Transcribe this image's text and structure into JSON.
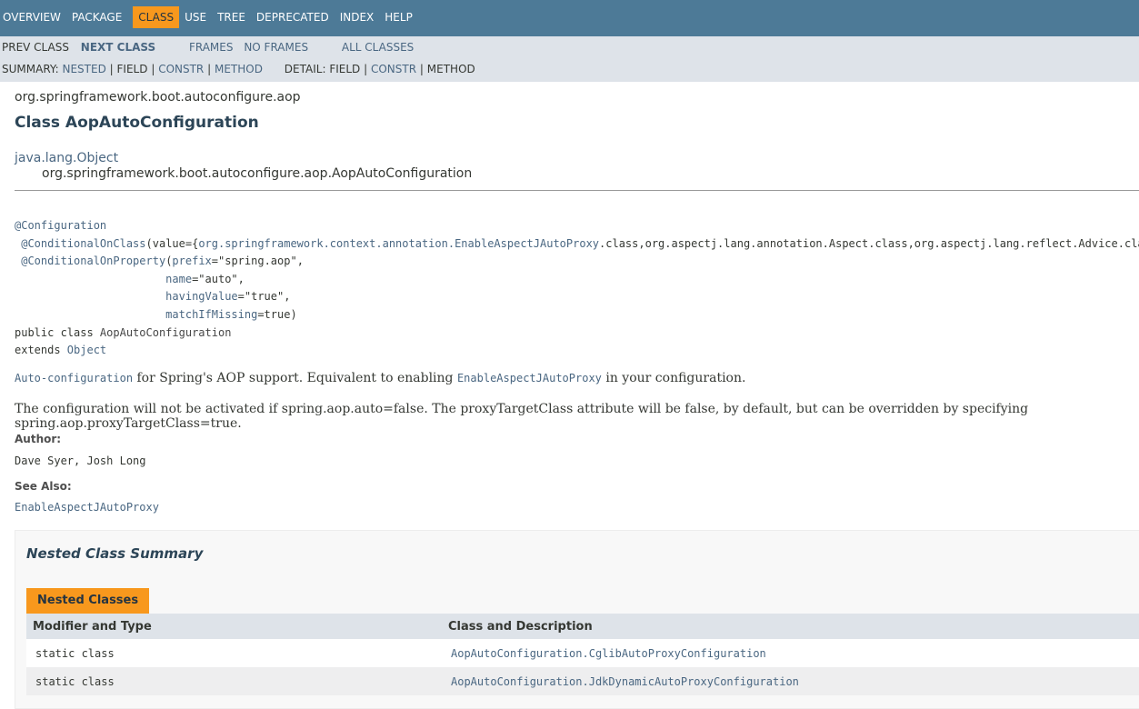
{
  "topnav": {
    "items": [
      "OVERVIEW",
      "PACKAGE",
      "CLASS",
      "USE",
      "TREE",
      "DEPRECATED",
      "INDEX",
      "HELP"
    ],
    "active": "CLASS"
  },
  "subnav": {
    "prev_class": "PREV CLASS",
    "next_class": "NEXT CLASS",
    "frames": "FRAMES",
    "no_frames": "NO FRAMES",
    "all_classes": "ALL CLASSES",
    "summary_label": "SUMMARY:",
    "summary_nested": "NESTED",
    "summary_field": "FIELD",
    "summary_constr": "CONSTR",
    "summary_method": "METHOD",
    "detail_label": "DETAIL:",
    "detail_field": "FIELD",
    "detail_constr": "CONSTR",
    "detail_method": "METHOD",
    "sep": "|"
  },
  "header": {
    "package": "org.springframework.boot.autoconfigure.aop",
    "title": "Class AopAutoConfiguration"
  },
  "inheritance": {
    "parent": "java.lang.Object",
    "self": "org.springframework.boot.autoconfigure.aop.AopAutoConfiguration"
  },
  "signature": {
    "ann1": "@Configuration",
    "ann2_name": "@ConditionalOnClass",
    "ann2_pre": "(value={",
    "ann2_link": "org.springframework.context.annotation.EnableAspectJAutoProxy",
    "ann2_post": ".class,org.aspectj.lang.annotation.Aspect.class,org.aspectj.lang.reflect.Advice.class})",
    "ann3_name": "@ConditionalOnProperty",
    "ann3_pre": "(",
    "ann3_p1": "prefix",
    "ann3_v1": "=\"spring.aop\",",
    "ann3_p2": "name",
    "ann3_v2": "=\"auto\",",
    "ann3_p3": "havingValue",
    "ann3_v3": "=\"true\",",
    "ann3_p4": "matchIfMissing",
    "ann3_v4": "=true)",
    "decl_pre": "public class ",
    "decl_name": "AopAutoConfiguration",
    "extends_pre": "extends ",
    "extends_link": "Object"
  },
  "description": {
    "p1_link": "Auto-configuration",
    "p1_mid": " for Spring's AOP support. Equivalent to enabling ",
    "p1_link2": "EnableAspectJAutoProxy",
    "p1_end": " in your configuration.",
    "p2": "The configuration will not be activated if spring.aop.auto=false. The proxyTargetClass attribute will be false, by default, but can be overridden by specifying spring.aop.proxyTargetClass=true."
  },
  "author": {
    "label": "Author:",
    "value": "Dave Syer, Josh Long"
  },
  "see_also": {
    "label": "See Also:",
    "link": "EnableAspectJAutoProxy"
  },
  "nested": {
    "heading": "Nested Class Summary",
    "caption": "Nested Classes",
    "col1": "Modifier and Type",
    "col2": "Class and Description",
    "rows": [
      {
        "modifier": "static class",
        "name": "AopAutoConfiguration.CglibAutoProxyConfiguration"
      },
      {
        "modifier": "static class",
        "name": "AopAutoConfiguration.JdkDynamicAutoProxyConfiguration"
      }
    ]
  },
  "colors": {
    "topnav_bg": "#4d7a97",
    "active_tab": "#f8981d",
    "subnav_bg": "#dee3e9",
    "link": "#4a6782"
  }
}
